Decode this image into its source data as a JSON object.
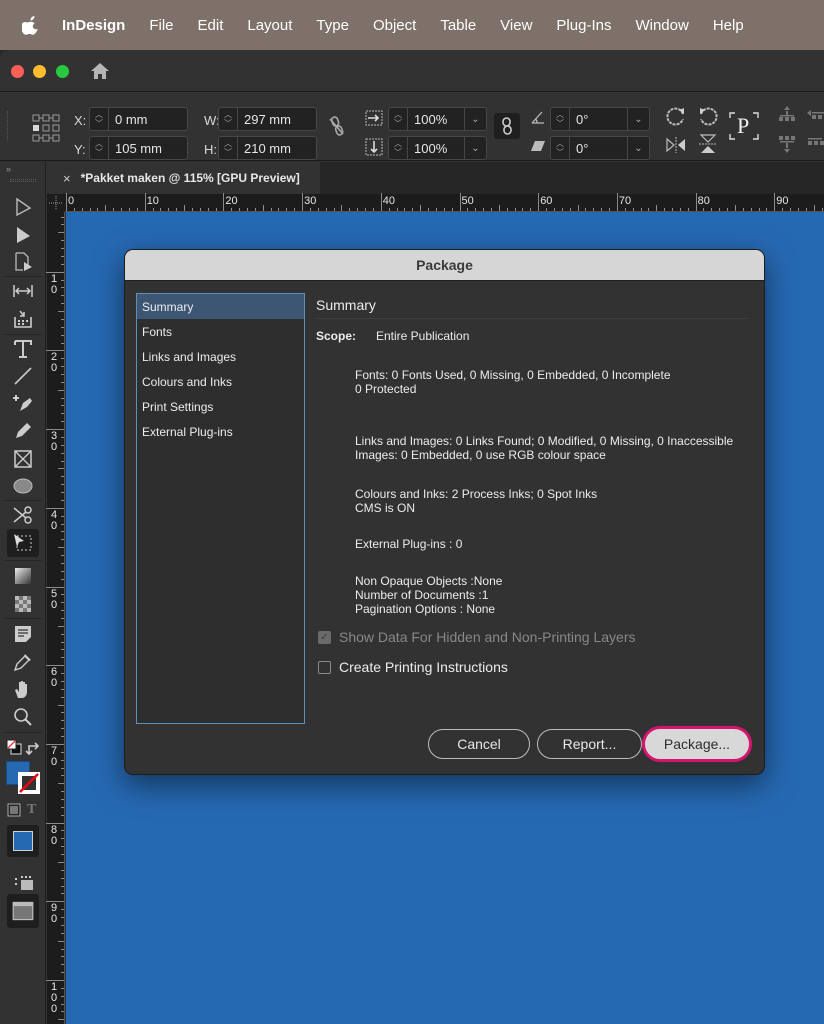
{
  "menubar": {
    "app_name": "InDesign",
    "items": [
      "File",
      "Edit",
      "Layout",
      "Type",
      "Object",
      "Table",
      "View",
      "Plug-Ins",
      "Window",
      "Help"
    ]
  },
  "window": {
    "traffic_lights": [
      "close",
      "minimize",
      "zoom"
    ],
    "home_icon": "home-icon"
  },
  "control_panel": {
    "x_label": "X:",
    "x_value": "0 mm",
    "y_label": "Y:",
    "y_value": "105 mm",
    "w_label": "W:",
    "w_value": "297 mm",
    "h_label": "H:",
    "h_value": "210 mm",
    "scale_x_value": "100%",
    "scale_y_value": "100%",
    "rotation_value": "0°",
    "shear_value": "0°",
    "type_icon_label": "P"
  },
  "document_tab": {
    "close_glyph": "×",
    "title": "*Pakket maken @ 115% [GPU Preview]"
  },
  "toolbox": {
    "collapse_glyph": "»",
    "tools": [
      "selection",
      "direct-selection",
      "page",
      "gap",
      "content-collector",
      "type",
      "line",
      "pen",
      "pencil",
      "rectangle-frame",
      "ellipse",
      "scissors",
      "free-transform",
      "gradient-swatch",
      "gradient-feather",
      "note",
      "eyedropper",
      "hand",
      "zoom"
    ]
  },
  "rulers": {
    "horizontal": [
      "0",
      "10",
      "20",
      "30",
      "40",
      "50",
      "60",
      "70",
      "80",
      "90"
    ],
    "vertical": [
      "10",
      "20",
      "30",
      "40",
      "50",
      "60",
      "70",
      "80",
      "90",
      "100"
    ]
  },
  "colors": {
    "canvas": "#2669b3",
    "fill_swatch": "#2669b3",
    "selection_outline": "#5f8fbf",
    "default_button_ring": "#d4146e"
  },
  "dialog": {
    "title": "Package",
    "nav": [
      "Summary",
      "Fonts",
      "Links and Images",
      "Colours and Inks",
      "Print Settings",
      "External Plug-ins"
    ],
    "selected_nav": "Summary",
    "panel_heading": "Summary",
    "scope_label": "Scope:",
    "scope_value": "Entire Publication",
    "fonts_line1": "Fonts: 0 Fonts Used, 0 Missing, 0 Embedded, 0 Incomplete",
    "fonts_line2": "0 Protected",
    "links_line1": "Links and Images: 0 Links Found; 0 Modified, 0 Missing, 0 Inaccessible",
    "links_line2": "Images: 0 Embedded, 0 use RGB colour space",
    "colours_line1": "Colours and Inks: 2 Process Inks; 0 Spot Inks",
    "colours_line2": "CMS is ON",
    "plugins_line": "External Plug-ins : 0",
    "misc_line1": "Non Opaque Objects :None",
    "misc_line2": "Number of Documents :1",
    "misc_line3": "Pagination Options : None",
    "show_hidden_label": "Show Data For Hidden and Non-Printing Layers",
    "show_hidden_checked": true,
    "show_hidden_disabled": true,
    "print_instructions_label": "Create Printing Instructions",
    "print_instructions_checked": false,
    "check_glyph": "✓",
    "cancel_label": "Cancel",
    "report_label": "Report...",
    "package_label": "Package..."
  }
}
